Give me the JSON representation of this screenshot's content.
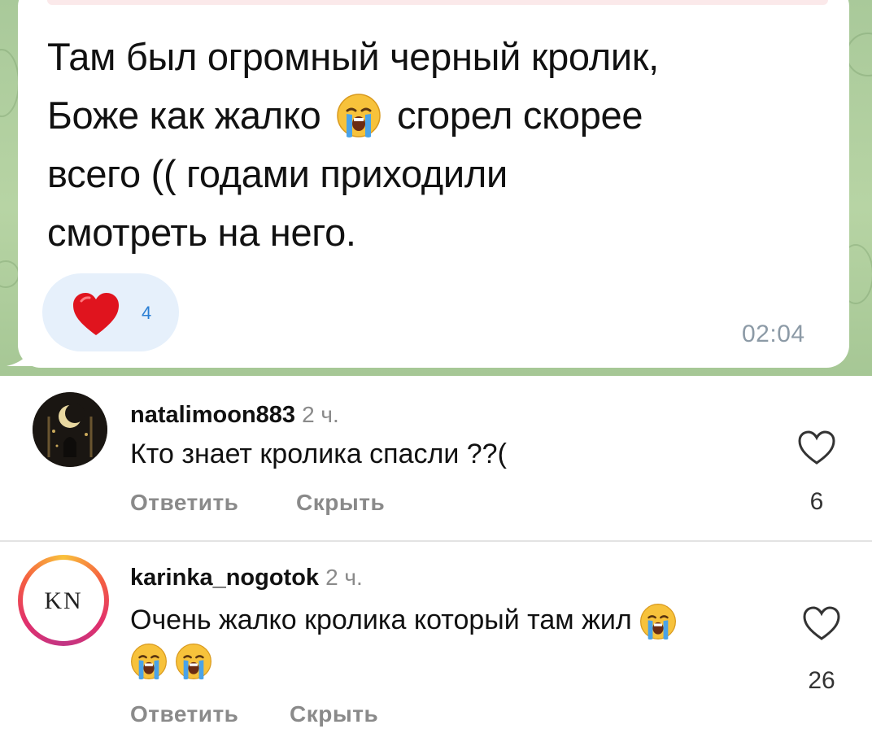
{
  "message": {
    "lines": [
      "Там был огромный черный кролик,",
      "Боже как жалко",
      "сгорел скорее",
      "всего (( годами приходили",
      "смотреть на него."
    ],
    "reaction": {
      "icon": "red-heart-icon",
      "count": "4"
    },
    "time": "02:04"
  },
  "comments": [
    {
      "username": "natalimoon883",
      "ago": "2 ч.",
      "text": "Кто знает кролика спасли ??(",
      "reply_label": "Ответить",
      "hide_label": "Скрыть",
      "like_count": "6",
      "avatar_icon": "moon-cat-avatar"
    },
    {
      "username": "karinka_nogotok",
      "ago": "2 ч.",
      "text": "Очень жалко кролика который там жил",
      "reply_label": "Ответить",
      "hide_label": "Скрыть",
      "like_count": "26",
      "avatar_text": "KN",
      "emoji_icon": "loudly-crying-face-icon"
    }
  ],
  "colors": {
    "telegram_bg": "#b7d4a4",
    "reaction_bg": "#e6f0fb",
    "heart": "#e0141e",
    "story_ring": "#e1306c"
  }
}
